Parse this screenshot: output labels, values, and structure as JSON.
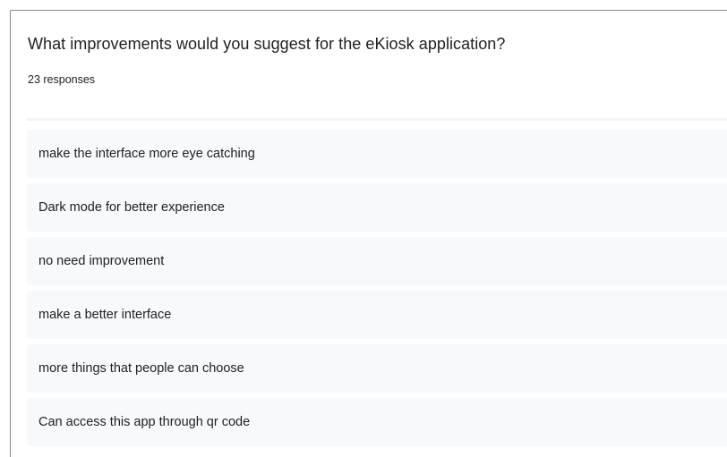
{
  "question": {
    "title": "What improvements would you suggest for the eKiosk application?",
    "response_count": "23 responses"
  },
  "responses": [
    "make the interface more eye catching",
    "Dark mode for better experience",
    "no need improvement",
    "make a better interface",
    "more things that people can choose",
    "Can access this app through qr code"
  ]
}
